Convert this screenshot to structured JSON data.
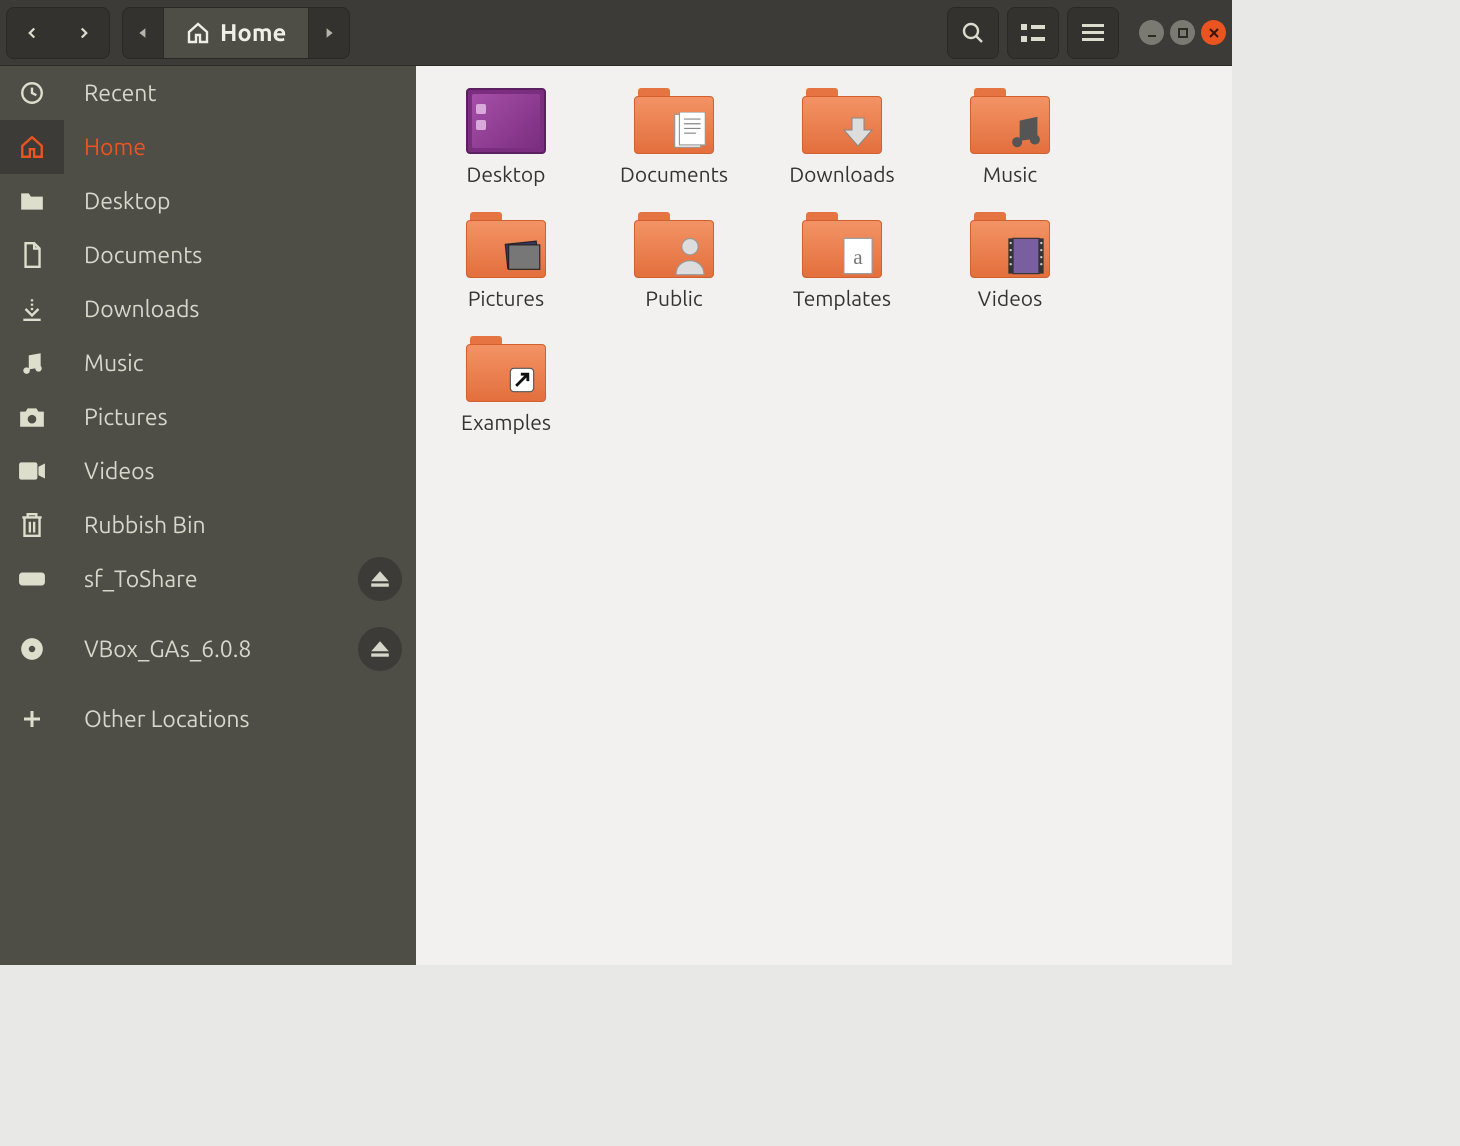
{
  "toolbar": {
    "path_label": "Home"
  },
  "sidebar": {
    "items": [
      {
        "icon": "clock-icon",
        "label": "Recent",
        "active": false,
        "eject": false
      },
      {
        "icon": "home-icon",
        "label": "Home",
        "active": true,
        "eject": false
      },
      {
        "icon": "folder-icon",
        "label": "Desktop",
        "active": false,
        "eject": false
      },
      {
        "icon": "file-icon",
        "label": "Documents",
        "active": false,
        "eject": false
      },
      {
        "icon": "download-icon",
        "label": "Downloads",
        "active": false,
        "eject": false
      },
      {
        "icon": "music-icon",
        "label": "Music",
        "active": false,
        "eject": false
      },
      {
        "icon": "camera-icon",
        "label": "Pictures",
        "active": false,
        "eject": false
      },
      {
        "icon": "video-icon",
        "label": "Videos",
        "active": false,
        "eject": false
      },
      {
        "icon": "trash-icon",
        "label": "Rubbish Bin",
        "active": false,
        "eject": false
      },
      {
        "icon": "drive-icon",
        "label": "sf_ToShare",
        "active": false,
        "eject": true
      },
      {
        "icon": "disc-icon",
        "label": "VBox_GAs_6.0.8",
        "active": false,
        "eject": true
      },
      {
        "icon": "plus-icon",
        "label": "Other Locations",
        "active": false,
        "eject": false
      }
    ]
  },
  "files": [
    {
      "kind": "desktop",
      "label": "Desktop"
    },
    {
      "kind": "folder",
      "overlay": "document",
      "label": "Documents"
    },
    {
      "kind": "folder",
      "overlay": "download",
      "label": "Downloads"
    },
    {
      "kind": "folder",
      "overlay": "music",
      "label": "Music"
    },
    {
      "kind": "folder",
      "overlay": "pictures",
      "label": "Pictures"
    },
    {
      "kind": "folder",
      "overlay": "person",
      "label": "Public"
    },
    {
      "kind": "folder",
      "overlay": "template",
      "label": "Templates"
    },
    {
      "kind": "folder",
      "overlay": "video",
      "label": "Videos"
    },
    {
      "kind": "folder",
      "overlay": "link",
      "label": "Examples"
    }
  ],
  "colors": {
    "accent": "#e95420",
    "folder": "#e67443",
    "toolbar": "#3c3b37",
    "sidebar": "#4e4d46"
  }
}
